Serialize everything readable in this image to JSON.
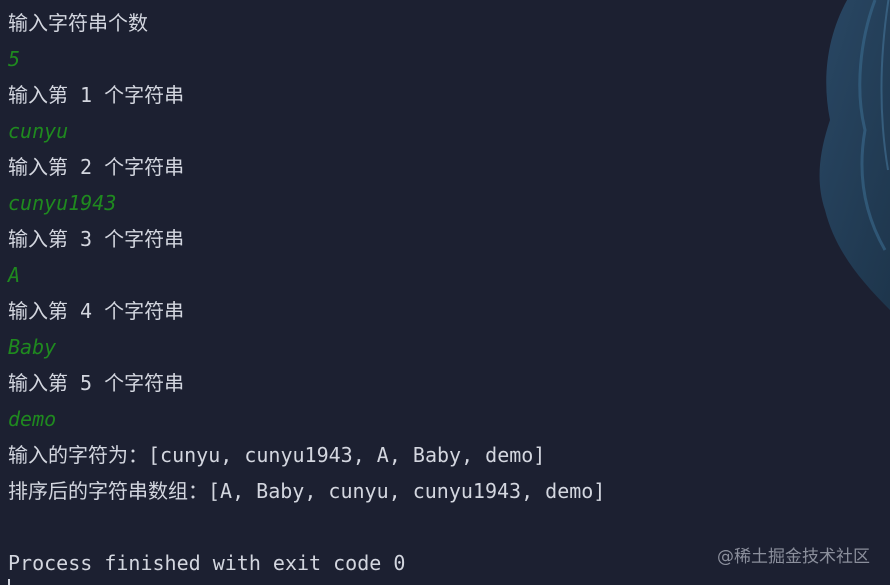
{
  "console": {
    "lines": [
      {
        "kind": "prompt",
        "text": "输入字符串个数"
      },
      {
        "kind": "input",
        "text": "5"
      },
      {
        "kind": "prompt",
        "text": "输入第 1 个字符串"
      },
      {
        "kind": "input",
        "text": "cunyu"
      },
      {
        "kind": "prompt",
        "text": "输入第 2 个字符串"
      },
      {
        "kind": "input",
        "text": "cunyu1943"
      },
      {
        "kind": "prompt",
        "text": "输入第 3 个字符串"
      },
      {
        "kind": "input",
        "text": "A"
      },
      {
        "kind": "prompt",
        "text": "输入第 4 个字符串"
      },
      {
        "kind": "input",
        "text": "Baby"
      },
      {
        "kind": "prompt",
        "text": "输入第 5 个字符串"
      },
      {
        "kind": "input",
        "text": "demo"
      },
      {
        "kind": "output",
        "text": "输入的字符为：[cunyu, cunyu1943, A, Baby, demo]"
      },
      {
        "kind": "output",
        "text": "排序后的字符串数组：[A, Baby, cunyu, cunyu1943, demo]"
      }
    ],
    "process_message": "Process finished with exit code 0"
  },
  "watermark": "@稀土掘金技术社区",
  "colors": {
    "background": "#1c2031",
    "text": "#d3d6df",
    "user_input": "#1f8a1f"
  }
}
